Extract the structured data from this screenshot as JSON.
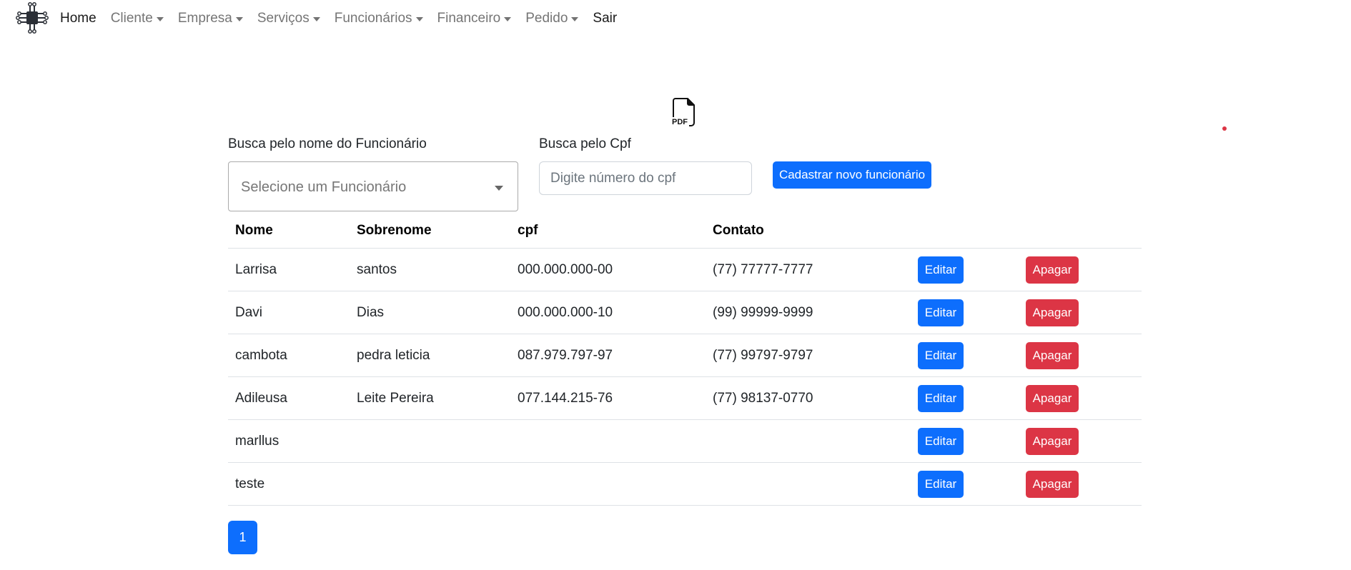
{
  "navbar": {
    "logo_icon": "circuit-chip-logo-icon",
    "items": [
      {
        "label": "Home",
        "dropdown": false,
        "strong": true
      },
      {
        "label": "Cliente",
        "dropdown": true,
        "strong": false
      },
      {
        "label": "Empresa",
        "dropdown": true,
        "strong": false
      },
      {
        "label": "Serviços",
        "dropdown": true,
        "strong": false
      },
      {
        "label": "Funcionários",
        "dropdown": true,
        "strong": false
      },
      {
        "label": "Financeiro",
        "dropdown": true,
        "strong": false
      },
      {
        "label": "Pedido",
        "dropdown": true,
        "strong": false
      },
      {
        "label": "Sair",
        "dropdown": false,
        "strong": true
      }
    ]
  },
  "pdf": {
    "icon": "pdf-file-icon",
    "text": "PDF"
  },
  "search": {
    "name_label": "Busca pelo nome do Funcionário",
    "name_select_value": "Selecione um Funcionário",
    "cpf_label": "Busca pelo Cpf",
    "cpf_placeholder": "Digite número do cpf",
    "new_button": "Cadastrar novo funcionário"
  },
  "table": {
    "headers": {
      "nome": "Nome",
      "sobrenome": "Sobrenome",
      "cpf": "cpf",
      "contato": "Contato"
    },
    "rows": [
      {
        "nome": "Larrisa",
        "sobrenome": "santos",
        "cpf": "000.000.000-00",
        "contato": "(77) 77777-7777",
        "edit": "Editar",
        "delete": "Apagar"
      },
      {
        "nome": "Davi",
        "sobrenome": "Dias",
        "cpf": "000.000.000-10",
        "contato": "(99) 99999-9999",
        "edit": "Editar",
        "delete": "Apagar"
      },
      {
        "nome": "cambota",
        "sobrenome": "pedra leticia",
        "cpf": "087.979.797-97",
        "contato": "(77) 99797-9797",
        "edit": "Editar",
        "delete": "Apagar"
      },
      {
        "nome": "Adileusa",
        "sobrenome": "Leite Pereira",
        "cpf": "077.144.215-76",
        "contato": "(77) 98137-0770",
        "edit": "Editar",
        "delete": "Apagar"
      },
      {
        "nome": "marllus",
        "sobrenome": "",
        "cpf": "",
        "contato": "",
        "edit": "Editar",
        "delete": "Apagar"
      },
      {
        "nome": "teste",
        "sobrenome": "",
        "cpf": "",
        "contato": "",
        "edit": "Editar",
        "delete": "Apagar"
      }
    ]
  },
  "pagination": {
    "current_page": "1"
  },
  "colors": {
    "primary": "#0d6efd",
    "danger": "#dc3545"
  }
}
